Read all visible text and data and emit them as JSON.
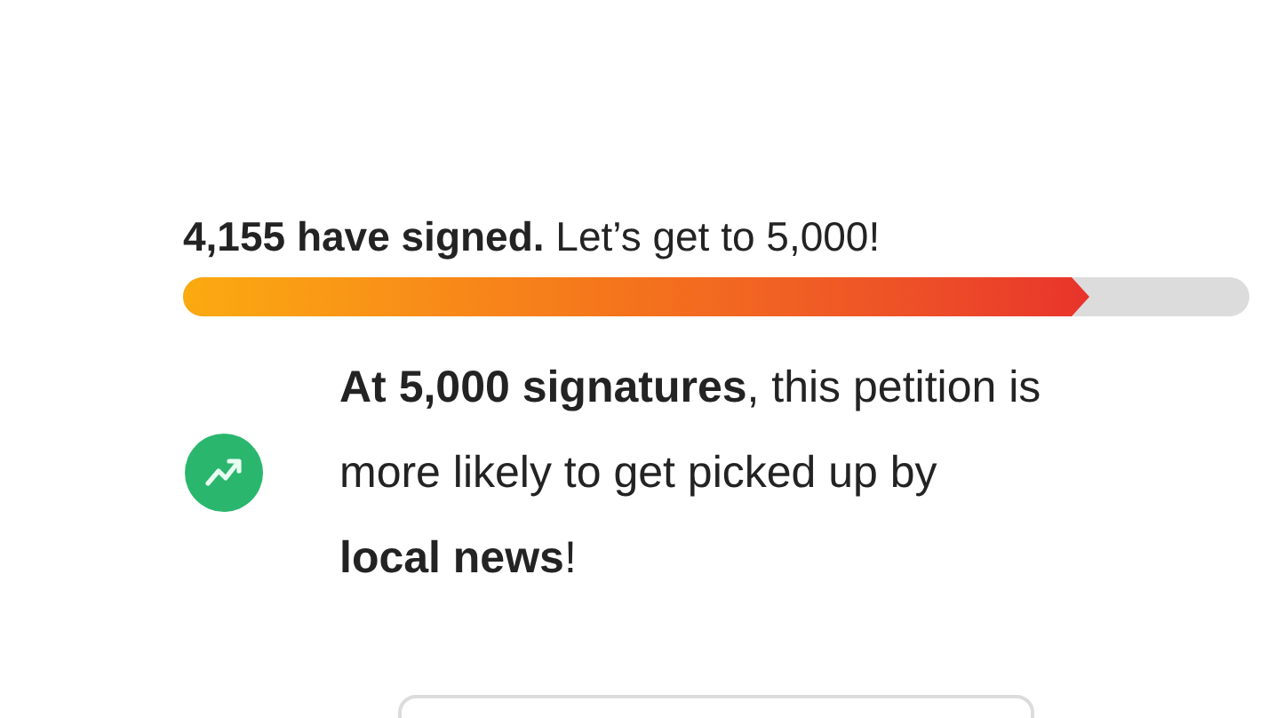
{
  "progress": {
    "heading": "**4,155 have signed.** Let’s get to 5,000!",
    "level": 0.85
  },
  "milestone": {
    "lines": [
      "**At 5,000 signatures**, this petition is",
      "more likely to get picked up by",
      "**local news**!"
    ]
  }
}
